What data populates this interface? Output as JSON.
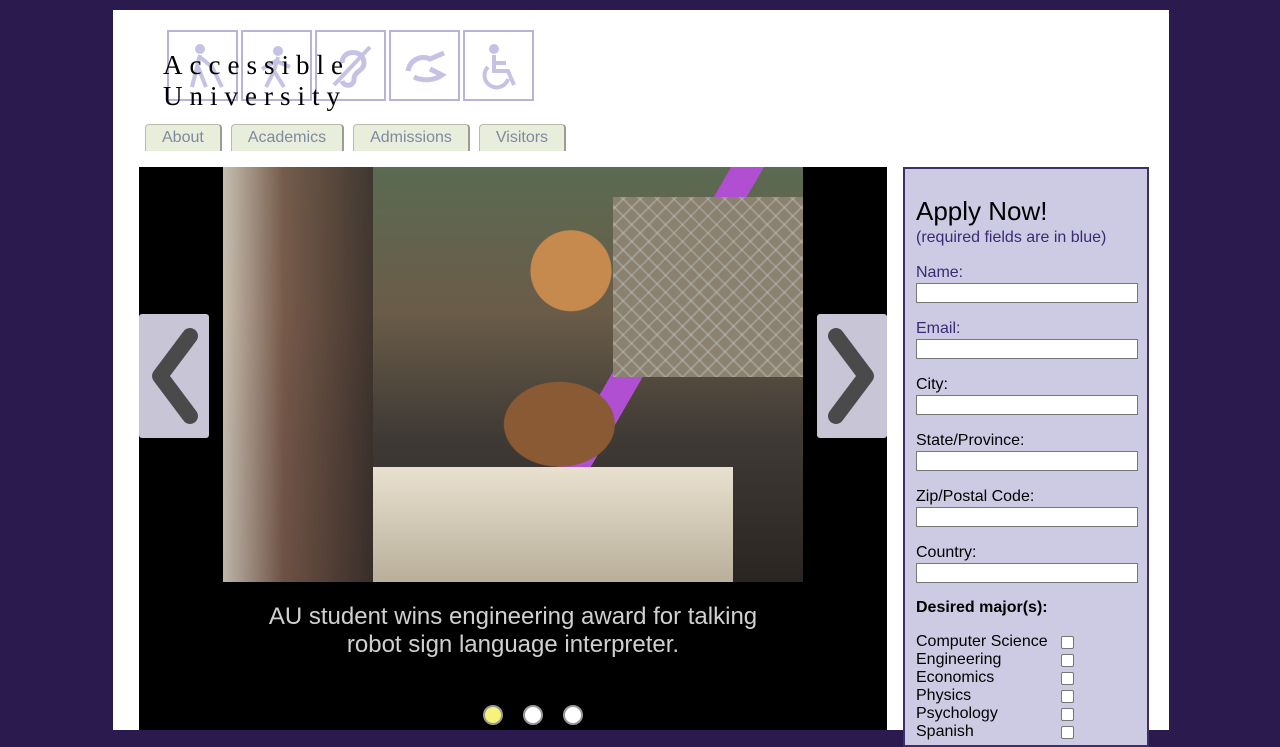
{
  "logo": {
    "text": "Accessible University",
    "icons": [
      "blind-person-icon",
      "walking-person-icon",
      "hearing-icon",
      "sign-language-icon",
      "wheelchair-icon"
    ]
  },
  "nav": {
    "tabs": [
      {
        "label": "About"
      },
      {
        "label": "Academics"
      },
      {
        "label": "Admissions"
      },
      {
        "label": "Visitors"
      }
    ]
  },
  "carousel": {
    "caption": "AU student wins engineering award for talking robot sign language interpreter.",
    "slides_count": 3,
    "active_slide": 1
  },
  "apply": {
    "title": "Apply Now!",
    "required_note": "(required fields are in blue)",
    "fields": [
      {
        "label": "Name:",
        "value": "",
        "required": true
      },
      {
        "label": "Email:",
        "value": "",
        "required": true
      },
      {
        "label": "City:",
        "value": "",
        "required": false
      },
      {
        "label": "State/Province:",
        "value": "",
        "required": false
      },
      {
        "label": "Zip/Postal Code:",
        "value": "",
        "required": false
      },
      {
        "label": "Country:",
        "value": "",
        "required": false
      }
    ],
    "majors_title": "Desired major(s):",
    "majors": [
      {
        "label": "Computer Science",
        "checked": false
      },
      {
        "label": "Engineering",
        "checked": false
      },
      {
        "label": "Economics",
        "checked": false
      },
      {
        "label": "Physics",
        "checked": false
      },
      {
        "label": "Psychology",
        "checked": false
      },
      {
        "label": "Spanish",
        "checked": false
      }
    ]
  },
  "colors": {
    "background": "#2b1a4e",
    "form_bg": "#cdcbe3",
    "required_label": "#3a2a72",
    "active_dot": "#f5f37a"
  }
}
